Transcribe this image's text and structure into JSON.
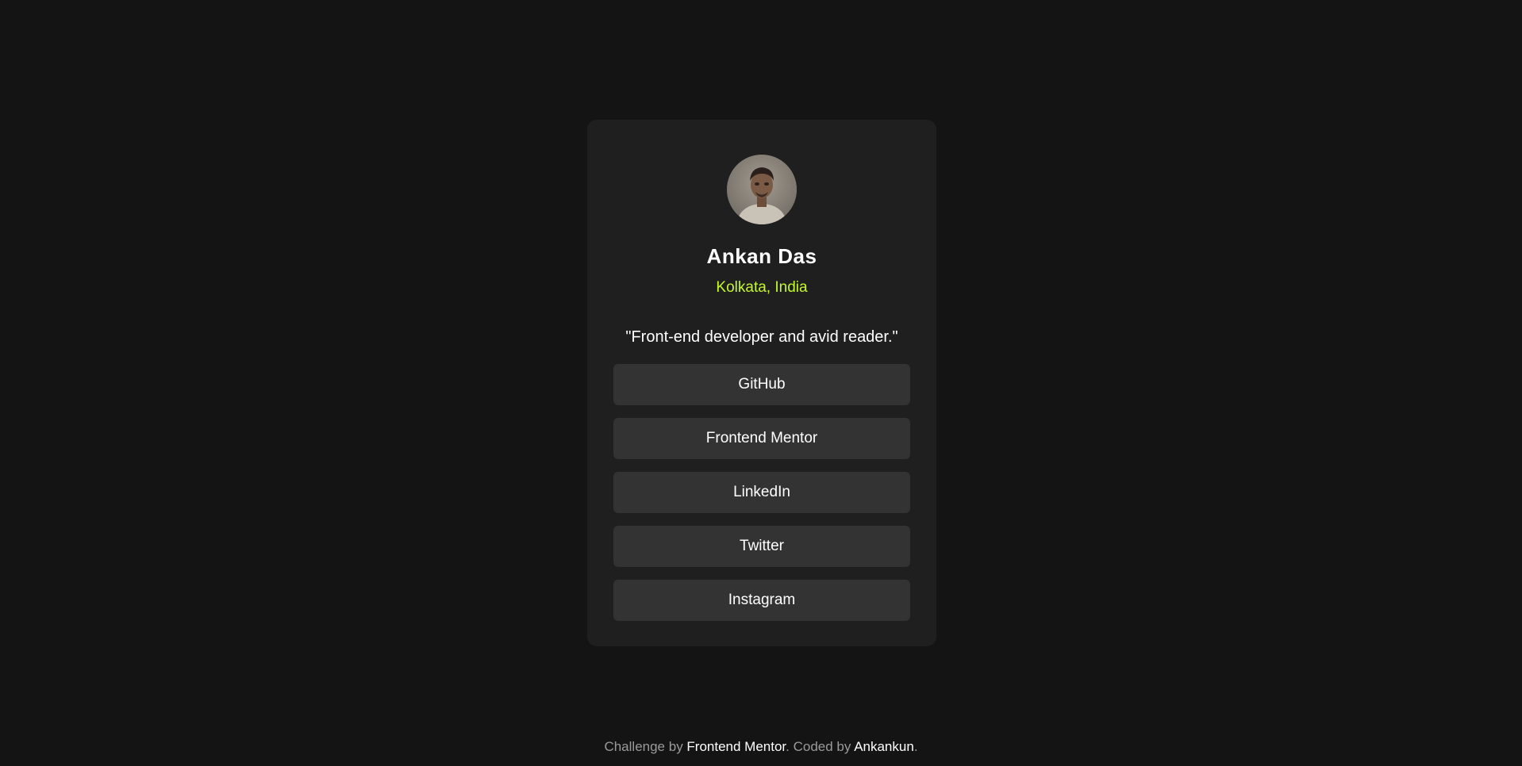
{
  "profile": {
    "name": "Ankan Das",
    "location": "Kolkata, India",
    "bio": "\"Front-end developer and avid reader.\""
  },
  "links": [
    {
      "label": "GitHub"
    },
    {
      "label": "Frontend Mentor"
    },
    {
      "label": "LinkedIn"
    },
    {
      "label": "Twitter"
    },
    {
      "label": "Instagram"
    }
  ],
  "footer": {
    "prefix": "Challenge by ",
    "challenge_link": "Frontend Mentor",
    "middle": ". Coded by ",
    "author_link": "Ankankun",
    "suffix": "."
  },
  "colors": {
    "page_background": "#141414",
    "card_background": "#1f1f1f",
    "button_background": "#333333",
    "accent_green": "#c4f82a",
    "footer_text": "#9a9a9a"
  }
}
